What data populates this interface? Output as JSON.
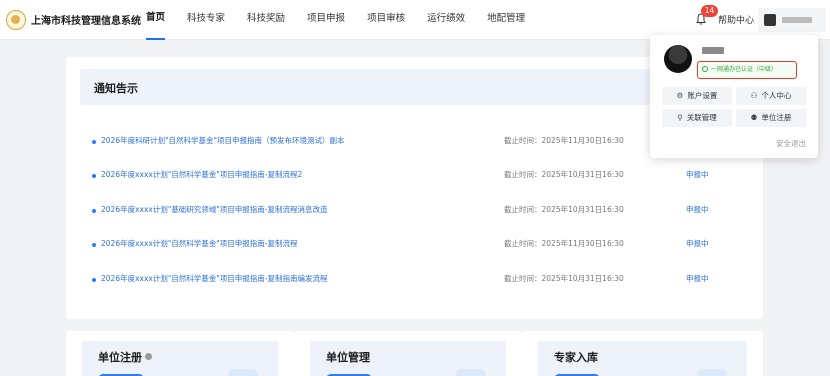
{
  "header": {
    "title": "上海市科技管理信息系统",
    "nav": [
      "首页",
      "科技专家",
      "科技奖励",
      "项目申报",
      "项目审核",
      "运行绩效",
      "地配管理"
    ],
    "notification_count": "14",
    "help_label": "帮助中心"
  },
  "notice": {
    "title": "通知告示",
    "rows": [
      {
        "title": "2026年度科研计划\"自然科学基金\"项目申报指南（预发布环境测试）副本",
        "deadline": "截止时间：2025年11月30日16:30",
        "status": ""
      },
      {
        "title": "2026年度xxxx计划\"自然科学基金\"项目申报指南-复制流程2",
        "deadline": "截止时间：2025年10月31日16:30",
        "status": "申报中"
      },
      {
        "title": "2026年度xxxx计划\"基础研究领域\"项目申报指南-复制流程消息改造",
        "deadline": "截止时间：2025年10月31日16:30",
        "status": "申报中"
      },
      {
        "title": "2026年度xxxx计划\"自然科学基金\"项目申报指南-复制流程",
        "deadline": "截止时间：2025年11月30日16:30",
        "status": "申报中"
      },
      {
        "title": "2026年度xxxx计划\"自然科学基金\"项目申报指南-复制指南编发流程",
        "deadline": "截止时间：2025年10月31日16:30",
        "status": "申报中"
      }
    ]
  },
  "cards": [
    {
      "title": "单位注册"
    },
    {
      "title": "单位管理"
    },
    {
      "title": "专家入库"
    }
  ],
  "dropdown": {
    "certification": "一网通办已认证（中级）",
    "buttons": [
      {
        "label": "账户设置",
        "icon": "gear-icon"
      },
      {
        "label": "个人中心",
        "icon": "person-icon"
      },
      {
        "label": "关联管理",
        "icon": "link-icon"
      },
      {
        "label": "单位注册",
        "icon": "org-icon"
      }
    ],
    "logout": "安全退出"
  },
  "colors": {
    "accent": "#1e6ff2",
    "link": "#2a6fdb",
    "badge": "#f04438",
    "cert_border": "#e23b2e",
    "cert_text": "#3aa84a"
  }
}
